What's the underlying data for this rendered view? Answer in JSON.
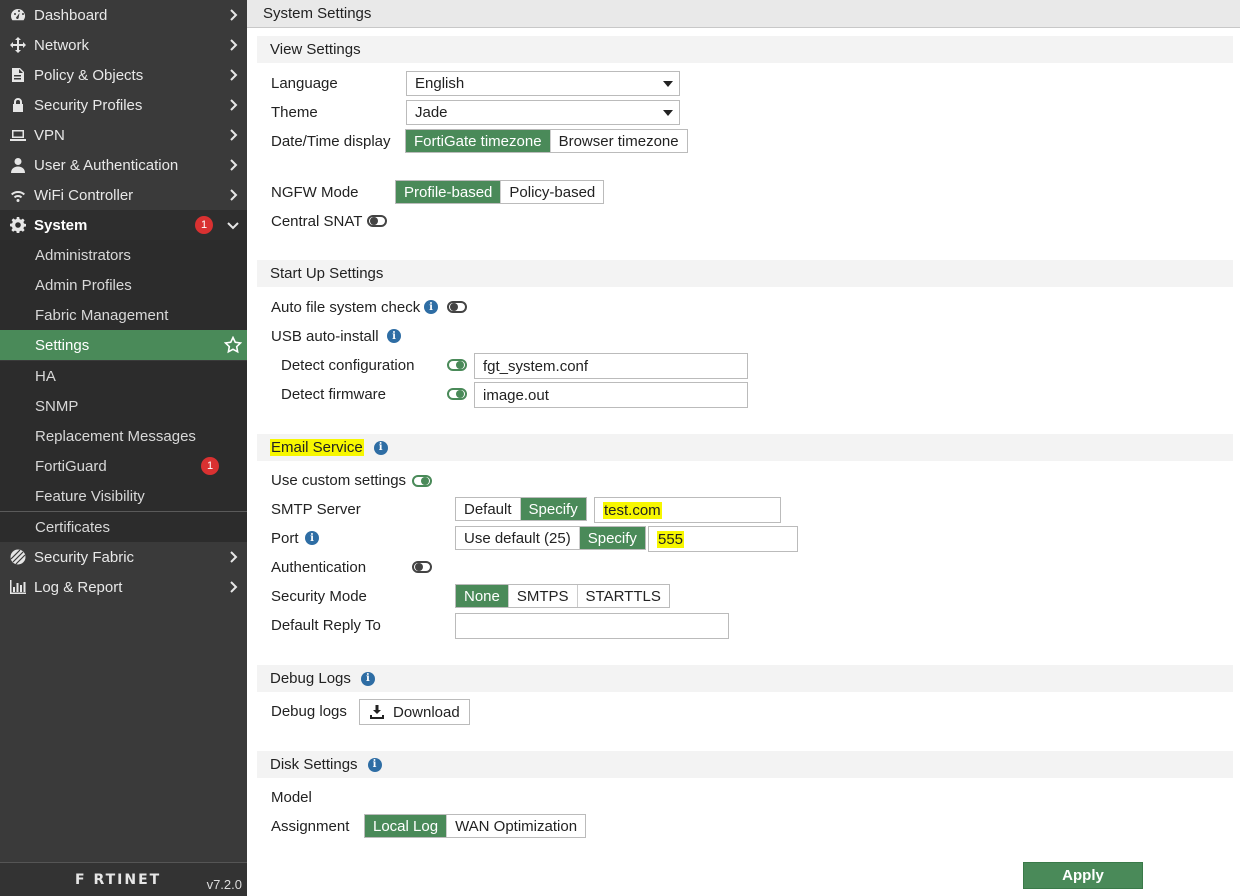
{
  "sidebar": {
    "items": [
      {
        "label": "Dashboard",
        "icon": "dashboard-icon"
      },
      {
        "label": "Network",
        "icon": "network-icon"
      },
      {
        "label": "Policy & Objects",
        "icon": "policy-icon"
      },
      {
        "label": "Security Profiles",
        "icon": "lock-icon"
      },
      {
        "label": "VPN",
        "icon": "laptop-icon"
      },
      {
        "label": "User & Authentication",
        "icon": "user-icon"
      },
      {
        "label": "WiFi Controller",
        "icon": "wifi-icon"
      },
      {
        "label": "System",
        "icon": "gear-icon",
        "badge": "1"
      }
    ],
    "system_sub": [
      {
        "label": "Administrators"
      },
      {
        "label": "Admin Profiles"
      },
      {
        "label": "Fabric Management"
      },
      {
        "label": "Settings"
      },
      {
        "label": "HA"
      },
      {
        "label": "SNMP"
      },
      {
        "label": "Replacement Messages"
      },
      {
        "label": "FortiGuard",
        "badge": "1"
      },
      {
        "label": "Feature Visibility"
      },
      {
        "label": "Certificates"
      }
    ],
    "bottom_items": [
      {
        "label": "Security Fabric",
        "icon": "security-fabric-icon"
      },
      {
        "label": "Log & Report",
        "icon": "chart-icon"
      }
    ],
    "logo": "F RTINET",
    "version": "v7.2.0"
  },
  "page_title": "System Settings",
  "view": {
    "header": "View Settings",
    "language_label": "Language",
    "language_value": "English",
    "theme_label": "Theme",
    "theme_value": "Jade",
    "datetime_label": "Date/Time display",
    "datetime_opt1": "FortiGate timezone",
    "datetime_opt2": "Browser timezone",
    "ngfw_label": "NGFW Mode",
    "ngfw_opt1": "Profile-based",
    "ngfw_opt2": "Policy-based",
    "snat_label": "Central SNAT"
  },
  "startup": {
    "header": "Start Up Settings",
    "autofs_label": "Auto file system check",
    "usb_label": "USB auto-install",
    "detect_config_label": "Detect configuration",
    "detect_config_value": "fgt_system.conf",
    "detect_fw_label": "Detect firmware",
    "detect_fw_value": "image.out"
  },
  "email": {
    "header": "Email Service",
    "custom_label": "Use custom settings",
    "smtp_label": "SMTP Server",
    "smtp_opt1": "Default",
    "smtp_opt2": "Specify",
    "smtp_value": "test.com",
    "port_label": "Port",
    "port_opt1": "Use default (25)",
    "port_opt2": "Specify",
    "port_value": "555",
    "auth_label": "Authentication",
    "secmode_label": "Security Mode",
    "secmode_opt1": "None",
    "secmode_opt2": "SMTPS",
    "secmode_opt3": "STARTTLS",
    "reply_label": "Default Reply To",
    "reply_value": ""
  },
  "debug": {
    "header": "Debug Logs",
    "logs_label": "Debug logs",
    "download_label": "Download"
  },
  "disk": {
    "header": "Disk Settings",
    "model_label": "Model",
    "assign_label": "Assignment",
    "assign_opt1": "Local Log",
    "assign_opt2": "WAN Optimization"
  },
  "apply_label": "Apply",
  "colors": {
    "accent": "#4a8a59",
    "sidebar": "#3a3a3a",
    "badge": "#d93131",
    "highlight": "#f7f700"
  }
}
